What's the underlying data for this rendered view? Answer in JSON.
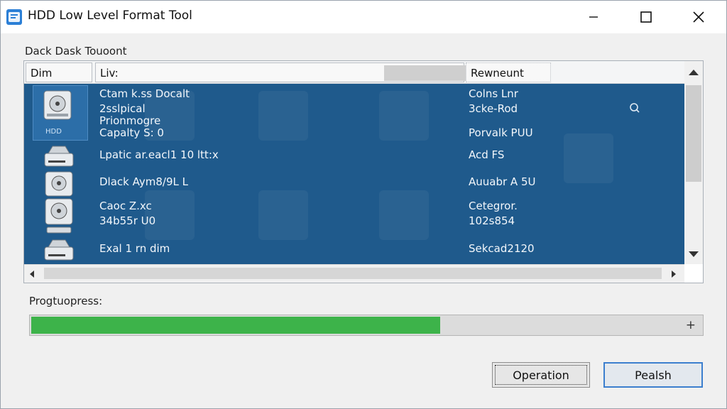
{
  "window": {
    "title": "HDD Low Level Format Tool"
  },
  "group_label": "Dack Dask Touoont",
  "list": {
    "columns": [
      "Dim",
      "Liv:",
      "Rewneunt"
    ],
    "selected_icon_caption": "HDD",
    "rows": [
      {
        "name_lines": [
          "Ctam k.ss Docalt",
          "2sslpical",
          "Prionmogre",
          "Capalty S:     0"
        ],
        "rem_lines": [
          "Colns Lnr",
          "3cke-Rod",
          "",
          "Porvalk PUU"
        ]
      },
      {
        "name_lines": [
          "Lpatic ar.eacl1 10 ltt:x"
        ],
        "rem_lines": [
          "Acd FS"
        ]
      },
      {
        "name_lines": [
          "Dlack Aym8/9L L"
        ],
        "rem_lines": [
          "Auuabr A 5U"
        ]
      },
      {
        "name_lines": [
          "Caoc Z.xc",
          "34b55r U0"
        ],
        "rem_lines": [
          "Cetegror.",
          "102s854"
        ]
      },
      {
        "name_lines": [
          "Exal 1 rn dim"
        ],
        "rem_lines": [
          "Sekcad2120"
        ]
      }
    ]
  },
  "progress": {
    "label": "Progtuopress:",
    "value_fraction": 0.61,
    "plus_label": "+",
    "fill_color": "#3db34a"
  },
  "buttons": {
    "operation_label": "Operation",
    "pealsh_label": "Pealsh"
  },
  "colors": {
    "selection_bg": "#1f5a8c",
    "accent": "#3c7fce"
  }
}
